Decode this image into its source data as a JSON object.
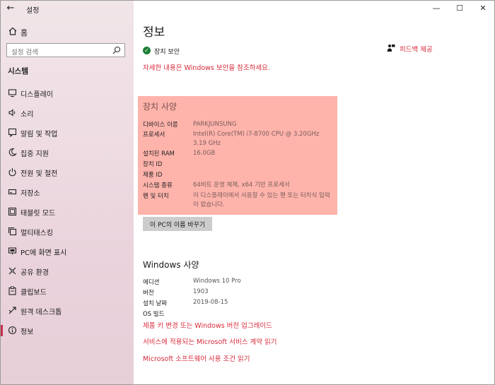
{
  "window": {
    "title": "설정"
  },
  "sidebar": {
    "home_label": "홈",
    "search_placeholder": "설정 검색",
    "section": "시스템",
    "items": [
      {
        "label": "디스플레이"
      },
      {
        "label": "소리"
      },
      {
        "label": "알림 및 작업"
      },
      {
        "label": "집중 지원"
      },
      {
        "label": "전원 및 절전"
      },
      {
        "label": "저장소"
      },
      {
        "label": "태블릿 모드"
      },
      {
        "label": "멀티태스킹"
      },
      {
        "label": "PC에 화면 표시"
      },
      {
        "label": "공유 환경"
      },
      {
        "label": "클립보드"
      },
      {
        "label": "원격 데스크톱"
      },
      {
        "label": "정보"
      }
    ],
    "active_index": 12
  },
  "main": {
    "title": "정보",
    "security_status": "장치 보안",
    "security_link": "자세한 내용은 Windows 보안을 참조하세요.",
    "feedback_link": "피드백 제공",
    "device_specs": {
      "title": "장치 사양",
      "rows": [
        {
          "key": "디바이스 이름",
          "value": "PARKJUNSUNG"
        },
        {
          "key": "프로세서",
          "value": "Intel(R) Core(TM) i7-8700 CPU @ 3.20GHz 3.19 GHz"
        },
        {
          "key": "설치된 RAM",
          "value": "16.0GB"
        },
        {
          "key": "장치 ID",
          "value": ""
        },
        {
          "key": "제품 ID",
          "value": ""
        },
        {
          "key": "시스템 종류",
          "value": "64비트 운영 체제, x64 기반 프로세서"
        },
        {
          "key": "펜 및 터치",
          "value": "이 디스플레이에서 사용할 수 있는 펜 또는 터치식 입력이 없습니다."
        }
      ]
    },
    "rename_button": "이 PC의 이름 바꾸기",
    "windows_specs": {
      "title": "Windows 사양",
      "rows": [
        {
          "key": "에디션",
          "value": "Windows 10 Pro"
        },
        {
          "key": "버전",
          "value": "1903"
        },
        {
          "key": "설치 날짜",
          "value": "2019-08-15"
        },
        {
          "key": "OS 빌드",
          "value": ""
        }
      ]
    },
    "links": [
      "제품 키 변경 또는 Windows 버전 업그레이드",
      "서비스에 적용되는 Microsoft 서비스 계약 읽기",
      "Microsoft 소프트웨어 사용 조건 읽기"
    ]
  },
  "colors": {
    "accent": "#d72a3a",
    "highlight": "#feb3ab",
    "status_ok": "#1b7f34"
  }
}
